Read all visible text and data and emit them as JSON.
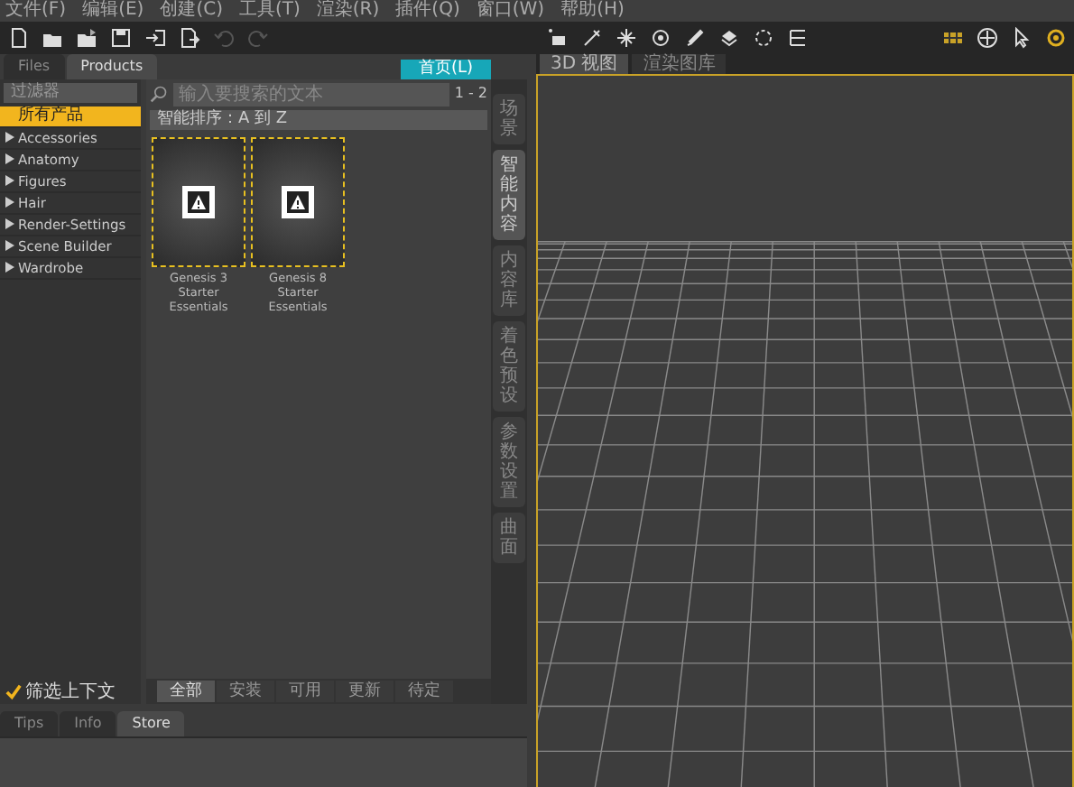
{
  "menu": [
    "文件(F)",
    "编辑(E)",
    "创建(C)",
    "工具(T)",
    "渲染(R)",
    "插件(Q)",
    "窗口(W)",
    "帮助(H)"
  ],
  "left_panel": {
    "tabs": [
      {
        "label": "Files",
        "selected": false
      },
      {
        "label": "Products",
        "selected": true
      }
    ],
    "home_button": "首页(L)",
    "filter_dropdown": "过滤器",
    "search": {
      "placeholder": "输入要搜索的文本"
    },
    "count": "1 - 2",
    "sort": "智能排序：A 到 Z",
    "categories": [
      {
        "label": "所有产品",
        "selected": true,
        "expandable": false
      },
      {
        "label": "Accessories",
        "selected": false,
        "expandable": true
      },
      {
        "label": "Anatomy",
        "selected": false,
        "expandable": true
      },
      {
        "label": "Figures",
        "selected": false,
        "expandable": true
      },
      {
        "label": "Hair",
        "selected": false,
        "expandable": true
      },
      {
        "label": "Render-Settings",
        "selected": false,
        "expandable": true
      },
      {
        "label": "Scene Builder",
        "selected": false,
        "expandable": true
      },
      {
        "label": "Wardrobe",
        "selected": false,
        "expandable": true
      }
    ],
    "products": [
      {
        "name": "Genesis 3 Starter Essentials"
      },
      {
        "name": "Genesis 8 Starter Essentials"
      }
    ],
    "filter_context": {
      "label": "筛选上下文",
      "checked": true
    },
    "status_tabs": [
      {
        "label": "全部",
        "selected": true
      },
      {
        "label": "安装",
        "selected": false
      },
      {
        "label": "可用",
        "selected": false
      },
      {
        "label": "更新",
        "selected": false
      },
      {
        "label": "待定",
        "selected": false
      }
    ],
    "side_tabs": [
      {
        "label": "场景",
        "selected": false
      },
      {
        "label": "智能内容",
        "selected": true
      },
      {
        "label": "内容库",
        "selected": false
      },
      {
        "label": "着色预设",
        "selected": false
      },
      {
        "label": "参数设置",
        "selected": false
      },
      {
        "label": "曲面",
        "selected": false
      }
    ]
  },
  "bottom_tabs": [
    {
      "label": "Tips",
      "selected": false
    },
    {
      "label": "Info",
      "selected": false
    },
    {
      "label": "Store",
      "selected": true
    }
  ],
  "viewport_tabs": [
    {
      "label": "3D 视图",
      "selected": true
    },
    {
      "label": "渲染图库",
      "selected": false
    }
  ]
}
